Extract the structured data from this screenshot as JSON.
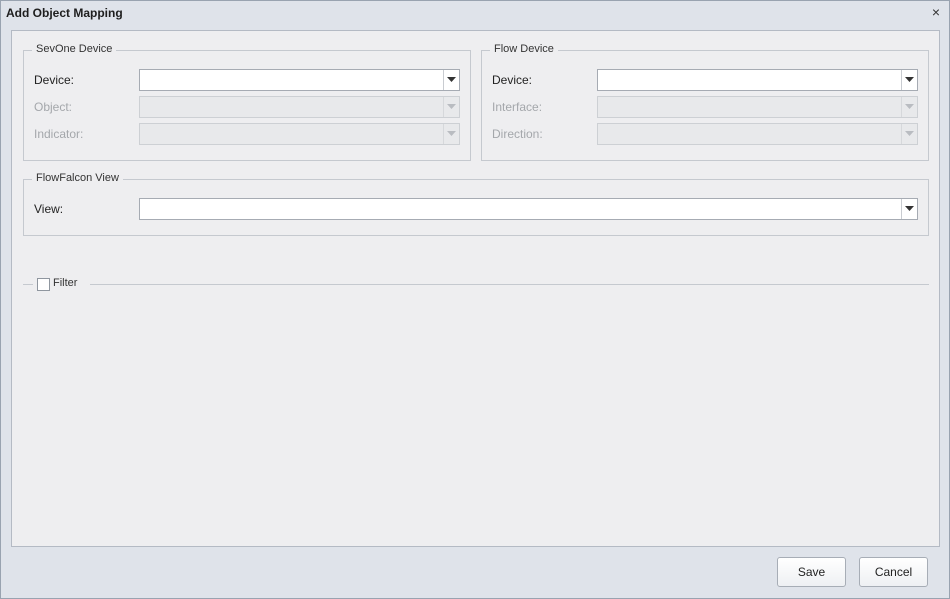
{
  "window": {
    "title": "Add Object Mapping",
    "close_glyph": "×"
  },
  "sevone_device": {
    "legend": "SevOne Device",
    "fields": [
      {
        "label": "Device:",
        "value": "",
        "enabled": true
      },
      {
        "label": "Object:",
        "value": "",
        "enabled": false
      },
      {
        "label": "Indicator:",
        "value": "",
        "enabled": false
      }
    ]
  },
  "flow_device": {
    "legend": "Flow Device",
    "fields": [
      {
        "label": "Device:",
        "value": "",
        "enabled": true
      },
      {
        "label": "Interface:",
        "value": "",
        "enabled": false
      },
      {
        "label": "Direction:",
        "value": "",
        "enabled": false
      }
    ]
  },
  "flowfalcon_view": {
    "legend": "FlowFalcon View",
    "view_label": "View:",
    "view_value": ""
  },
  "filter": {
    "label": "Filter",
    "checked": false
  },
  "buttons": {
    "save": "Save",
    "cancel": "Cancel"
  },
  "icons": {
    "dropdown": "chevron-down-icon",
    "close": "close-icon"
  }
}
